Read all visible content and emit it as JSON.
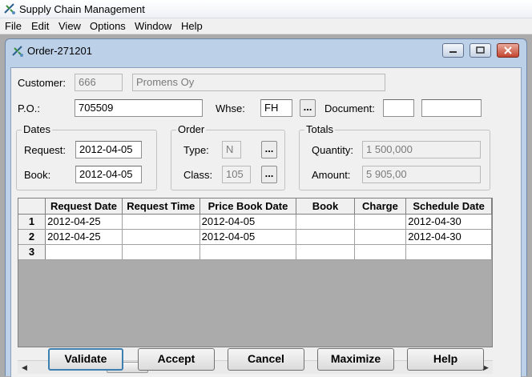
{
  "app": {
    "title": "Supply Chain Management"
  },
  "menu": [
    "File",
    "Edit",
    "View",
    "Options",
    "Window",
    "Help"
  ],
  "window": {
    "title": "Order-271201"
  },
  "form": {
    "customer_label": "Customer:",
    "customer_id": "666",
    "customer_name": "Promens Oy",
    "po_label": "P.O.:",
    "po_value": "705509",
    "whse_label": "Whse:",
    "whse_value": "FH",
    "browse_label": "...",
    "document_label": "Document:",
    "document_value1": "",
    "document_value2": ""
  },
  "dates": {
    "caption": "Dates",
    "request_label": "Request:",
    "request_value": "2012-04-05",
    "book_label": "Book:",
    "book_value": "2012-04-05"
  },
  "order": {
    "caption": "Order",
    "type_label": "Type:",
    "type_value": "N",
    "class_label": "Class:",
    "class_value": "105",
    "browse_label": "..."
  },
  "totals": {
    "caption": "Totals",
    "quantity_label": "Quantity:",
    "quantity_value": "1 500,000",
    "amount_label": "Amount:",
    "amount_value": "5 905,00"
  },
  "grid": {
    "columns": [
      "Request Date",
      "Request Time",
      "Price Book Date",
      "Book",
      "Charge",
      "Schedule Date"
    ],
    "rows": [
      {
        "num": "1",
        "cells": [
          "2012-04-25",
          "",
          "2012-04-05",
          "",
          "",
          "2012-04-30"
        ]
      },
      {
        "num": "2",
        "cells": [
          "2012-04-25",
          "",
          "2012-04-05",
          "",
          "",
          "2012-04-30"
        ]
      },
      {
        "num": "3",
        "cells": [
          "",
          "",
          "",
          "",
          "",
          ""
        ]
      }
    ]
  },
  "buttons": {
    "validate": "Validate",
    "accept": "Accept",
    "cancel": "Cancel",
    "maximize": "Maximize",
    "help": "Help"
  },
  "icons": {
    "app": "app-icon",
    "minimize": "minimize-icon",
    "restore": "restore-icon",
    "close": "close-icon",
    "scroll_left": "scroll-left-icon",
    "scroll_right": "scroll-right-icon"
  }
}
